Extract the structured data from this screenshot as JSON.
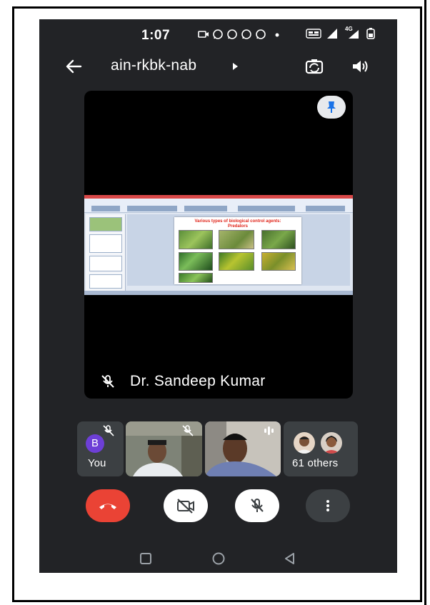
{
  "status_bar": {
    "time": "1:07",
    "network_label": "4G"
  },
  "topbar": {
    "meeting_code": "ain-rkbk-nab"
  },
  "main_video": {
    "speaker_name": "Dr. Sandeep Kumar",
    "slide_title_line1": "Various types of biological control agents:",
    "slide_title_line2": "Predators"
  },
  "participants": {
    "self_initial": "B",
    "self_label": "You",
    "others_label": "61 others"
  },
  "colors": {
    "background": "#222326",
    "end_call": "#ea4335",
    "tile": "#3c4043",
    "avatar": "#6d3fd6",
    "pin_badge": "#1a73e8"
  }
}
